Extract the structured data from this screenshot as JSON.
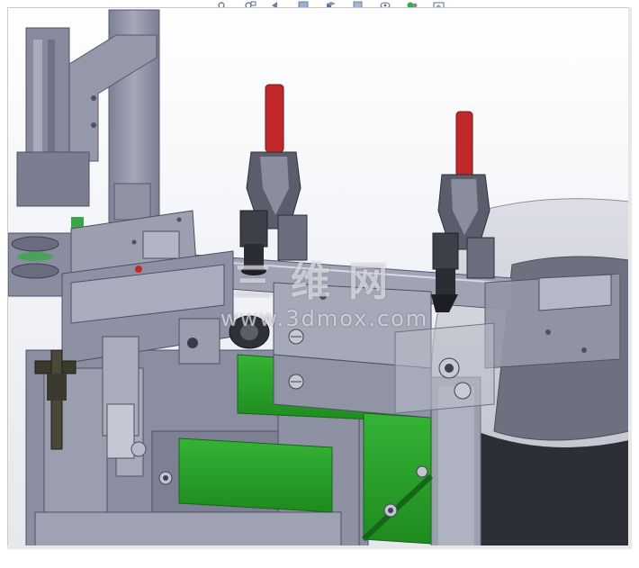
{
  "app": {
    "window_title": ""
  },
  "toolbar": {
    "icons": [
      "zoom-to-fit-icon",
      "zoom-area-icon",
      "previous-view-icon",
      "section-view-icon",
      "view-orientation-icon",
      "display-style-icon",
      "hide-show-icon",
      "appearance-icon",
      "scene-icon"
    ]
  },
  "viewport": {
    "model_description": "",
    "watermark": {
      "cn_text": "三维网",
      "url_text": "www.3dmox.com"
    }
  },
  "colors": {
    "frame_gray": "#8a8d9e",
    "frame_light": "#a6a9b8",
    "green_plate": "#2ea82e",
    "clamp_red": "#c0282a",
    "dark_part": "#4a4c57",
    "viewport_bg": "#eef0f5"
  }
}
